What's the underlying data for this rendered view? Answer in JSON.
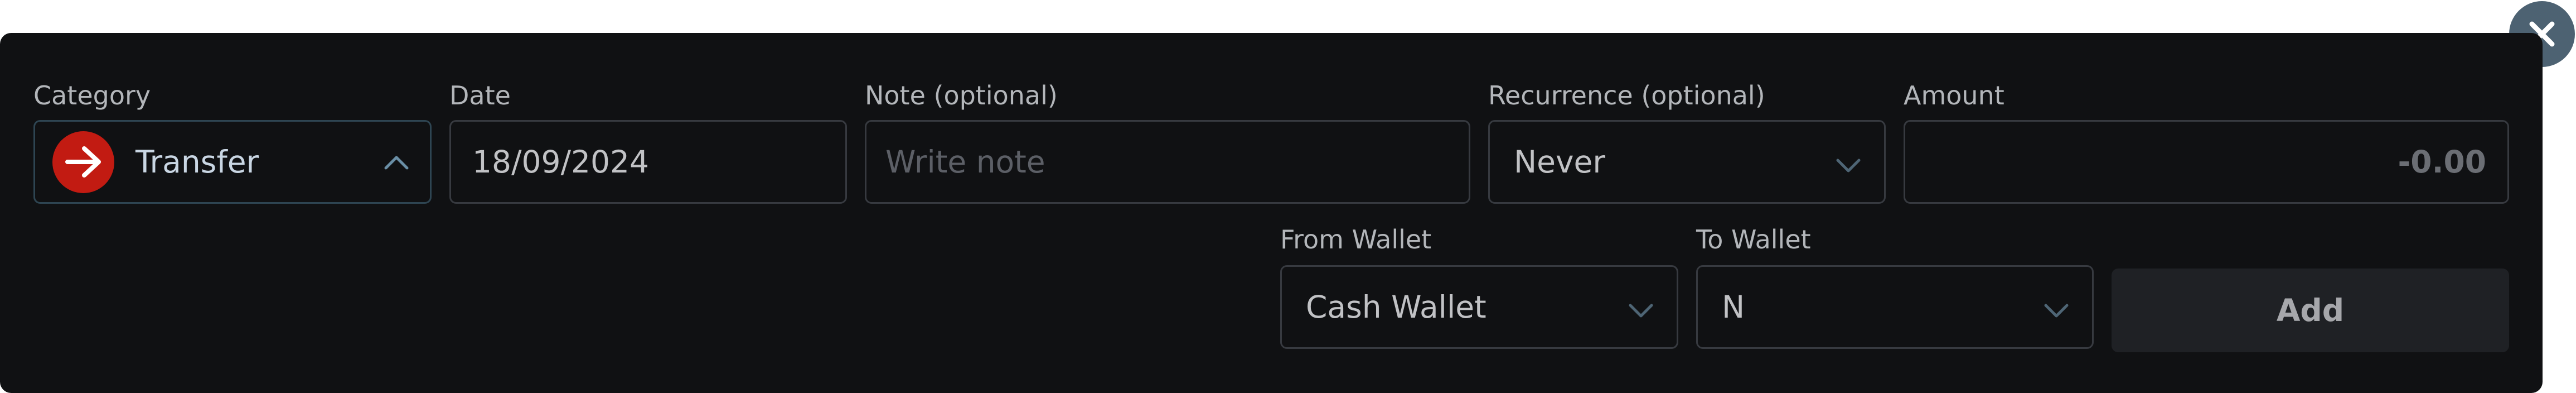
{
  "form": {
    "category": {
      "label": "Category",
      "value": "Transfer",
      "icon": "arrow-right-icon",
      "icon_color": "#c21b12"
    },
    "date": {
      "label": "Date",
      "value": "18/09/2024"
    },
    "note": {
      "label": "Note (optional)",
      "placeholder": "Write note",
      "value": ""
    },
    "recurrence": {
      "label": "Recurrence (optional)",
      "value": "Never"
    },
    "amount": {
      "label": "Amount",
      "value": "-0.00"
    },
    "from_wallet": {
      "label": "From Wallet",
      "value": "Cash Wallet"
    },
    "to_wallet": {
      "label": "To Wallet",
      "value": "N"
    },
    "add_button_label": "Add"
  },
  "colors": {
    "panel_background": "#101113",
    "close_button": "#4d6272",
    "accent_border": "#2e4552"
  }
}
